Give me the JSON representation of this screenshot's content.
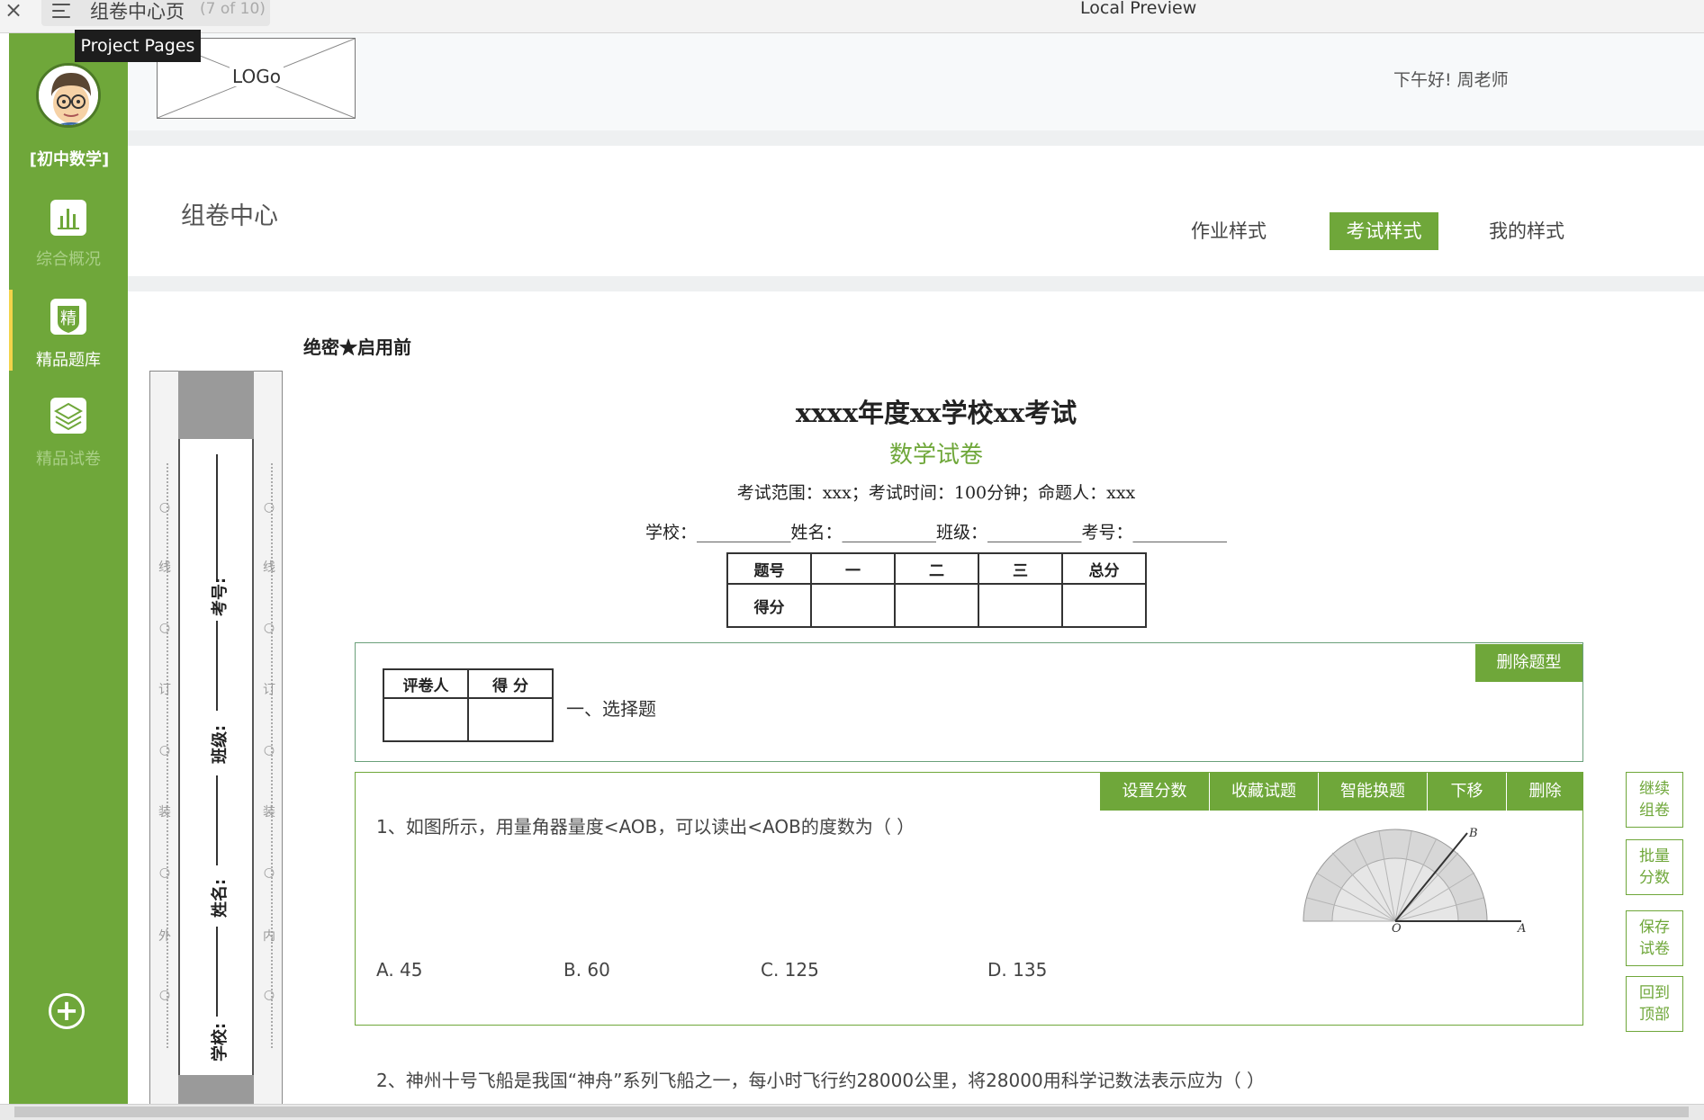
{
  "window": {
    "close_glyph": "×",
    "tab_title": "组卷中心页",
    "tab_count": "(7 of 10)",
    "preview_title": "Local Preview",
    "tooltip": "Project Pages"
  },
  "sidebar": {
    "subject": "[初中数学]",
    "items": [
      {
        "label": "综合概况",
        "icon": "bar-chart-icon",
        "active": false
      },
      {
        "label": "精品题库",
        "icon": "badge-jing-icon",
        "active": true
      },
      {
        "label": "精品试卷",
        "icon": "layers-icon",
        "active": false
      }
    ],
    "add_glyph": "+",
    "colors": {
      "bg": "#6fa73a",
      "active_marker": "#f3d34a",
      "inactive_text": "#a9cf86"
    }
  },
  "header": {
    "logo": "LOGo",
    "greeting": "下午好! 周老师"
  },
  "panel": {
    "title": "组卷中心",
    "tabs": [
      {
        "label": "作业样式",
        "active": false
      },
      {
        "label": "考试样式",
        "active": true
      },
      {
        "label": "我的样式",
        "active": false
      }
    ]
  },
  "binding_strip": {
    "outer_chars": [
      "外",
      "装",
      "订",
      "线"
    ],
    "inner_chars": [
      "内",
      "装",
      "订",
      "线"
    ],
    "circle_glyph": "○",
    "fields": [
      "学校:",
      "姓名:",
      "班级:",
      "考号:"
    ]
  },
  "exam": {
    "secret": "绝密★启用前",
    "title": "xxxx年度xx学校xx考试",
    "subtitle": "数学试卷",
    "info": "考试范围：xxx；考试时间：100分钟；命题人：xxx",
    "student_line": "学校：___________姓名：___________班级：___________考号：___________",
    "score_table": {
      "headers": [
        "题号",
        "一",
        "二",
        "三",
        "总分"
      ],
      "row_label": "得分"
    }
  },
  "section": {
    "grader_headers": [
      "评卷人",
      "得 分"
    ],
    "title": "一、选择题",
    "delete_label": "删除题型"
  },
  "question_toolbar": [
    "设置分数",
    "收藏试题",
    "智能换题",
    "下移",
    "删除"
  ],
  "questions": [
    {
      "text": "1、如图所示，用量角器量度<AOB，可以读出<AOB的度数为（     ）",
      "options": [
        "A.  45",
        "B.  60",
        "C.  125",
        "D.  135"
      ],
      "figure_labels": [
        "B",
        "O",
        "A"
      ]
    },
    {
      "text": "2、神州十号飞船是我国“神舟”系列飞船之一，每小时飞行约28000公里，将28000用科学记数法表示应为（     ）"
    }
  ],
  "side_buttons": [
    [
      "继续",
      "组卷"
    ],
    [
      "批量",
      "分数"
    ],
    [
      "保存",
      "试卷"
    ],
    [
      "回到",
      "顶部"
    ]
  ]
}
